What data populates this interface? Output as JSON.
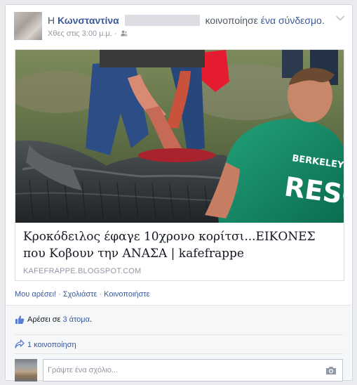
{
  "post": {
    "prefix": "Η",
    "author": "Κωνσταντίνα",
    "action": "κοινοποίησε",
    "link_label": "ένα σύνδεσμο",
    "period": ".",
    "timestamp": "Χθες στις 3:00 μ.μ.",
    "separator": " · "
  },
  "attachment": {
    "title": "Κροκόδειλος έφαγε 10χρονο κορίτσι...ΕΙΚΟΝΕΣ που Κοβουν την ΑΝΑΣΑ | kafefrappe",
    "source": "KAFEFRAPPE.BLOGSPOT.COM",
    "photo_text": [
      "BERKELEY CO",
      "RESC"
    ]
  },
  "actions": {
    "like": "Μου αρέσει!",
    "comment": "Σχολιάστε",
    "share": "Κοινοποιήστε",
    "dot": " · "
  },
  "ufi": {
    "likes_prefix": "Αρέσει σε",
    "likes_count": "3 άτομα",
    "likes_suffix": ".",
    "shares": "1 κοινοποίηση",
    "comment_placeholder": "Γράψτε ένα σχόλιο..."
  },
  "colors": {
    "link": "#3b5998",
    "muted": "#9197a3",
    "background": "#e9ebee"
  }
}
